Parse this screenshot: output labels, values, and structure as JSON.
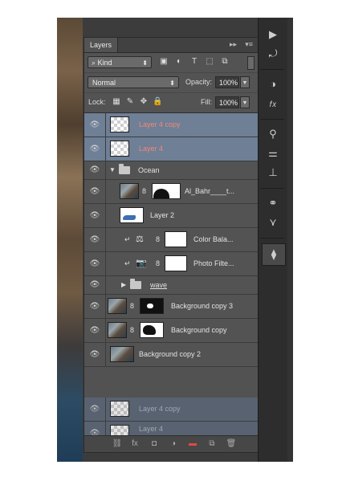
{
  "panel": {
    "tab_label": "Layers",
    "collapse_glyph": "▸▸",
    "menu_glyph": "▾≡"
  },
  "filter": {
    "kind_label": "⌕ Kind",
    "chevron": "⬍",
    "icons": [
      "image-filter-icon",
      "adjustment-filter-icon",
      "type-filter-icon",
      "shape-filter-icon",
      "smart-object-filter-icon"
    ],
    "icon_glyphs": [
      "▣",
      "◐",
      "T",
      "⬚",
      "⧉"
    ]
  },
  "blend": {
    "mode": "Normal",
    "opacity_label": "Opacity:",
    "opacity_value": "100%",
    "fill_label": "Fill:",
    "fill_value": "100%"
  },
  "lock": {
    "label": "Lock:",
    "icon_glyphs": [
      "▦",
      "✎",
      "✥",
      "🔒"
    ]
  },
  "layers": [
    {
      "name": "Layer 4 copy",
      "selected": true
    },
    {
      "name": "Layer 4",
      "selected": true
    },
    {
      "name": "Ocean"
    },
    {
      "name": "Al_Bahr____t..."
    },
    {
      "name": "Layer 2"
    },
    {
      "name": "Color Bala..."
    },
    {
      "name": "Photo Filte..."
    },
    {
      "name": "wave"
    },
    {
      "name": "Background copy 3"
    },
    {
      "name": "Background copy"
    },
    {
      "name": "Background copy 2"
    }
  ],
  "drag_ghost": {
    "layer_a": "Layer 4 copy",
    "layer_b": "Layer 4"
  },
  "glyphs": {
    "eye": "👁",
    "chain": "8",
    "clip_arrow": "↵",
    "expanded": "▼",
    "collapsed": "▶",
    "balance": "⚖",
    "camera": "📷"
  },
  "bottom_bar": {
    "icons": [
      "link-layers-icon",
      "layer-style-icon",
      "add-mask-icon",
      "new-adjustment-icon",
      "new-group-icon",
      "new-layer-icon",
      "delete-layer-icon"
    ],
    "glyphs": [
      "⛓",
      "fx",
      "◘",
      "◑",
      "▬",
      "⧉",
      "🗑"
    ]
  },
  "tool_strip": {
    "glyphs": [
      "▶",
      "⤾",
      "◑",
      "𝑓𝑥",
      "⚲",
      "⚌",
      "⊥",
      "⚭",
      "⋎",
      "⧫"
    ]
  },
  "colors": {
    "panel_bg": "#535353",
    "selected_row": "#6e7f96",
    "highlight_red": "#d85a56",
    "active_trash_red": "#e04a3d"
  }
}
